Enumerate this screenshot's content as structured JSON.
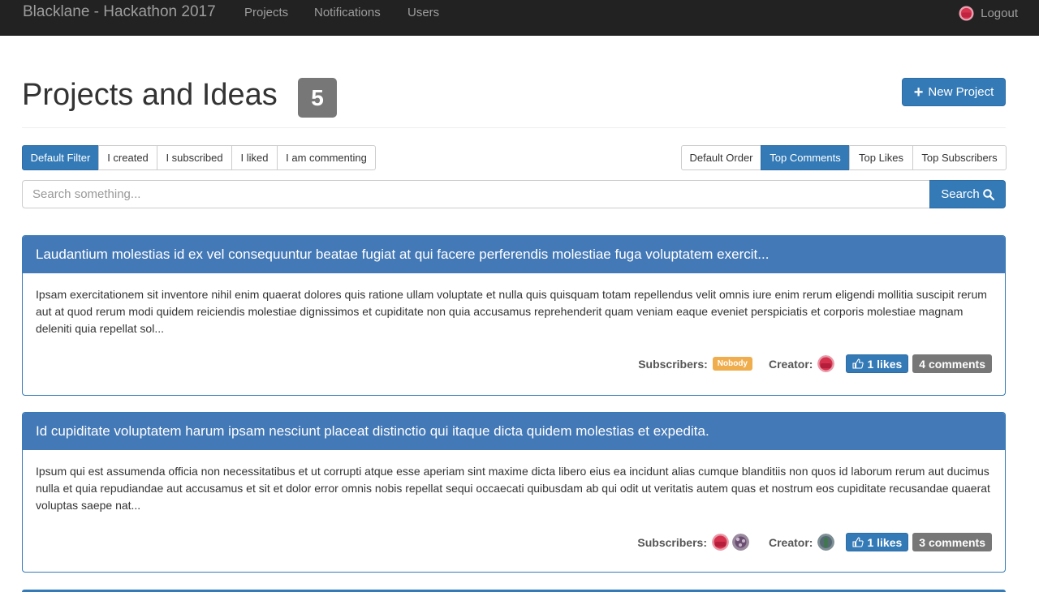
{
  "navbar": {
    "brand": "Blacklane - Hackathon 2017",
    "links": [
      "Projects",
      "Notifications",
      "Users"
    ],
    "logout": "Logout"
  },
  "header": {
    "title": "Projects and Ideas",
    "count": "5",
    "new_project": "New Project"
  },
  "filters": [
    "Default Filter",
    "I created",
    "I subscribed",
    "I liked",
    "I am commenting"
  ],
  "orders": [
    "Default Order",
    "Top Comments",
    "Top Likes",
    "Top Subscribers"
  ],
  "search": {
    "placeholder": "Search something...",
    "button": "Search"
  },
  "labels": {
    "subscribers": "Subscribers:",
    "creator": "Creator:",
    "nobody": "Nobody"
  },
  "projects": [
    {
      "title": "Laudantium molestias id ex vel consequuntur beatae fugiat at qui facere perferendis molestiae fuga voluptatem exercit...",
      "body": "Ipsam exercitationem sit inventore nihil enim quaerat dolores quis ratione ullam voluptate et nulla quis quisquam totam repellendus velit omnis iure enim rerum eligendi mollitia suscipit rerum aut at quod rerum modi quidem reiciendis molestiae dignissimos et cupiditate non quia accusamus reprehenderit quam veniam eaque eveniet perspiciatis et corporis molestiae magnam deleniti quia repellat sol...",
      "likes": "1 likes",
      "comments": "4 comments"
    },
    {
      "title": "Id cupiditate voluptatem harum ipsam nesciunt placeat distinctio qui itaque dicta quidem molestias et expedita.",
      "body": "Ipsum qui est assumenda officia non necessitatibus et ut corrupti atque esse aperiam sint maxime dicta libero eius ea incidunt alias cumque blanditiis non quos id laborum rerum aut ducimus nulla et quia repudiandae aut accusamus et sit et dolor error omnis nobis repellat sequi occaecati quibusdam ab qui odit ut veritatis autem quas et nostrum eos cupiditate recusandae quaerat voluptas saepe nat...",
      "likes": "1 likes",
      "comments": "3 comments"
    }
  ],
  "colors": {
    "primary": "#337ab7",
    "panel_heading": "#4479b7",
    "warning": "#f0ad4e",
    "default_badge": "#777777",
    "navbar": "#222222"
  }
}
